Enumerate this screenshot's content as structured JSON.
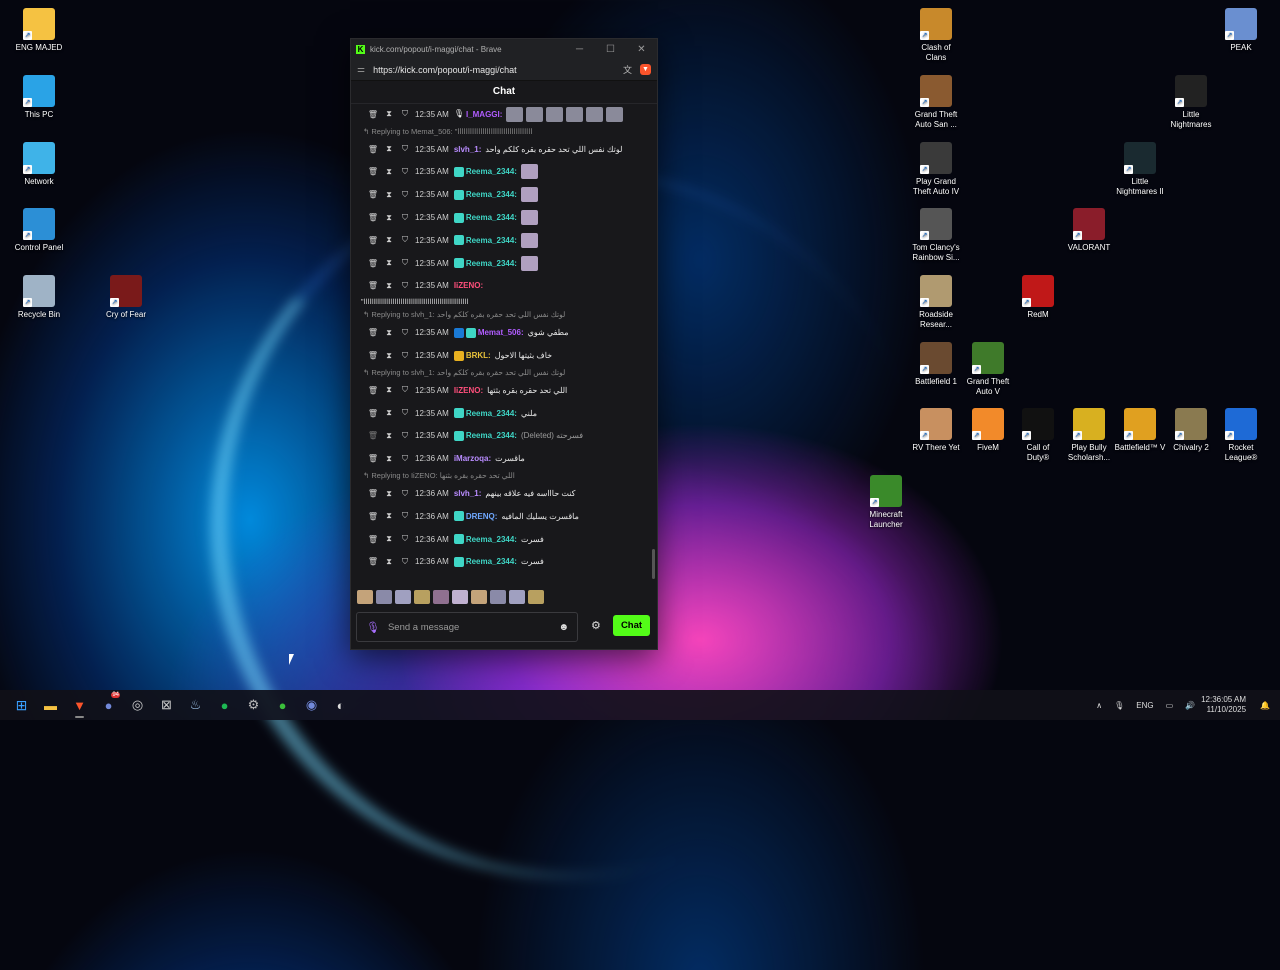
{
  "desktop": {
    "left_icons": [
      {
        "label": "ENG MAJED",
        "color": "#f5c242"
      },
      {
        "label": "This PC",
        "color": "#2aa3e6"
      },
      {
        "label": "Network",
        "color": "#3fb3e8"
      },
      {
        "label": "Control Panel",
        "color": "#2c8fd6"
      },
      {
        "label": "Recycle Bin",
        "color": "#9fb3c6"
      },
      {
        "label": "Cry of Fear",
        "color": "#7a1a1a"
      }
    ],
    "right_icons": [
      {
        "label": "Clash of\nClans",
        "color": "#c8892b"
      },
      {
        "label": "PEAK",
        "color": "#6a8fd0"
      },
      {
        "label": "Grand Theft\nAuto San ...",
        "color": "#8a5a30"
      },
      {
        "label": "Little\nNightmares",
        "color": "#222222"
      },
      {
        "label": "Play Grand\nTheft Auto IV",
        "color": "#3a3a3a"
      },
      {
        "label": "Little\nNightmares II",
        "color": "#1a2a30"
      },
      {
        "label": "Tom Clancy's\nRainbow Si...",
        "color": "#555555"
      },
      {
        "label": "VALORANT",
        "color": "#8a1d2a"
      },
      {
        "label": "Roadside\nResear...",
        "color": "#b09a70"
      },
      {
        "label": "RedM",
        "color": "#c01818"
      },
      {
        "label": "Battlefield 1",
        "color": "#6a4a30"
      },
      {
        "label": "Grand Theft\nAuto V",
        "color": "#3f7a2a"
      },
      {
        "label": "RV There Yet",
        "color": "#c89060"
      },
      {
        "label": "FiveM",
        "color": "#f28a2a"
      },
      {
        "label": "Call of\nDuty®",
        "color": "#111111"
      },
      {
        "label": "Play Bully\nScholarsh...",
        "color": "#d8b020"
      },
      {
        "label": "Battlefield™ V",
        "color": "#e0a020"
      },
      {
        "label": "Chivalry 2",
        "color": "#8a7a50"
      },
      {
        "label": "Rocket\nLeague®",
        "color": "#1e6ad6"
      },
      {
        "label": "Minecraft\nLauncher",
        "color": "#3a8a2a"
      }
    ]
  },
  "browser": {
    "title": "kick.com/popout/i-maggi/chat - Brave",
    "url": "https://kick.com/popout/i-maggi/chat",
    "shields_count": "3"
  },
  "chat": {
    "header": "Chat",
    "lines": [
      {
        "kind": "msg",
        "time": "12:35 AM",
        "user": "I_MAGGI",
        "user_color": "#b05cff",
        "text": "",
        "emotes": 6,
        "badge": "mic"
      },
      {
        "kind": "reply",
        "text": "Replying to Memat_506: \"اااااااااااااااااااااااااااااااااااا"
      },
      {
        "kind": "msg",
        "time": "12:35 AM",
        "user": "slvh_1",
        "user_color": "#b98cff",
        "text": "لوتك نفس اللي تحد حقره بقره كلكم واحد"
      },
      {
        "kind": "msg",
        "time": "12:35 AM",
        "user": "Reema_2344",
        "user_color": "#3fd6c6",
        "text": "",
        "emotes": 1,
        "badge": "sub"
      },
      {
        "kind": "msg",
        "time": "12:35 AM",
        "user": "Reema_2344",
        "user_color": "#3fd6c6",
        "text": "",
        "emotes": 1,
        "badge": "sub"
      },
      {
        "kind": "msg",
        "time": "12:35 AM",
        "user": "Reema_2344",
        "user_color": "#3fd6c6",
        "text": "",
        "emotes": 1,
        "badge": "sub"
      },
      {
        "kind": "msg",
        "time": "12:35 AM",
        "user": "Reema_2344",
        "user_color": "#3fd6c6",
        "text": "",
        "emotes": 1,
        "badge": "sub"
      },
      {
        "kind": "msg",
        "time": "12:35 AM",
        "user": "Reema_2344",
        "user_color": "#3fd6c6",
        "text": "",
        "emotes": 1,
        "badge": "sub"
      },
      {
        "kind": "msg",
        "time": "12:35 AM",
        "user": "IiZENO",
        "user_color": "#ff4f7b",
        "text": ""
      },
      {
        "kind": "wrap",
        "text": "\"اااااااااااااااااااااااااااااااااااااااااااااااااااااا"
      },
      {
        "kind": "reply",
        "text": "Replying to slvh_1: لوتك نفس اللي تحد حقره بقره كلكم واحد"
      },
      {
        "kind": "msg",
        "time": "12:35 AM",
        "user": "Memat_506",
        "user_color": "#b05cff",
        "text": "مطفي شوي",
        "badge": "sub2"
      },
      {
        "kind": "msg",
        "time": "12:35 AM",
        "user": "BRKL",
        "user_color": "#e8c23a",
        "text": "خاف بثيتها الاحول",
        "badge": "crown"
      },
      {
        "kind": "reply",
        "text": "Replying to slvh_1: لوتك نفس اللي تحد حقره بقره كلكم واحد"
      },
      {
        "kind": "msg",
        "time": "12:35 AM",
        "user": "IiZENO",
        "user_color": "#ff4f7b",
        "text": "اللي تحد حقره بقره بثتها"
      },
      {
        "kind": "msg",
        "time": "12:35 AM",
        "user": "Reema_2344",
        "user_color": "#3fd6c6",
        "text": "ملني",
        "badge": "sub"
      },
      {
        "kind": "msg",
        "time": "12:35 AM",
        "user": "Reema_2344",
        "user_color": "#3fd6c6",
        "text": "فسرحته (Deleted)",
        "badge": "sub",
        "deleted": true
      },
      {
        "kind": "msg",
        "time": "12:36 AM",
        "user": "iMarzoqa",
        "user_color": "#b98cff",
        "text": "ماقسرت"
      },
      {
        "kind": "reply",
        "text": "Replying to IiZENO: اللي تحد حقره بقره بثتها"
      },
      {
        "kind": "msg",
        "time": "12:36 AM",
        "user": "slvh_1",
        "user_color": "#b98cff",
        "text": "كنت حاااسه فيه علاقه بينهم"
      },
      {
        "kind": "msg",
        "time": "12:36 AM",
        "user": "DRENQ",
        "user_color": "#6fa8ff",
        "text": "ماقسرت يسليك المافيه",
        "badge": "sub"
      },
      {
        "kind": "msg",
        "time": "12:36 AM",
        "user": "Reema_2344",
        "user_color": "#3fd6c6",
        "text": "فسرت",
        "badge": "sub"
      },
      {
        "kind": "msg",
        "time": "12:36 AM",
        "user": "Reema_2344",
        "user_color": "#3fd6c6",
        "text": "فسرت",
        "badge": "sub"
      }
    ],
    "input_placeholder": "Send a message",
    "send_label": "Chat"
  },
  "taskbar": {
    "apps": [
      "start-icon",
      "file-explorer-icon",
      "brave-icon",
      "discord-badge-icon",
      "game-bar-icon",
      "xbox-icon",
      "steam-icon",
      "spotify-icon",
      "settings-icon",
      "xbox-app-icon",
      "discord-icon",
      "chrome-icon"
    ],
    "lang": "ENG",
    "time": "12:36:05 AM",
    "date": "11/10/2025",
    "discord_badge": "94"
  }
}
